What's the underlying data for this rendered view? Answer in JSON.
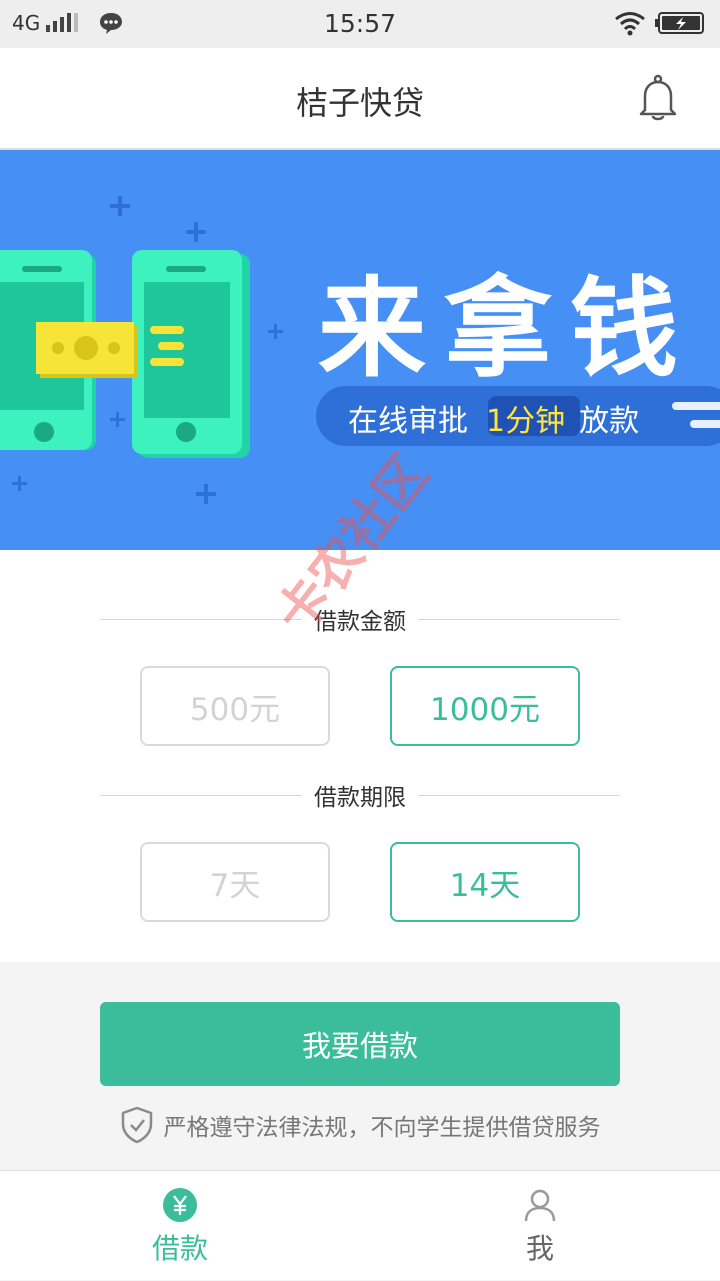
{
  "status_bar": {
    "network": "4G",
    "time": "15:57"
  },
  "header": {
    "title": "桔子快贷"
  },
  "banner": {
    "headline": "来拿钱",
    "subtitle_pre": "在线审批",
    "subtitle_highlight": "1分钟",
    "subtitle_post": "放款"
  },
  "amount": {
    "title": "借款金额",
    "options": [
      "500元",
      "1000元"
    ],
    "selected_index": 1
  },
  "term": {
    "title": "借款期限",
    "options": [
      "7天",
      "14天"
    ],
    "selected_index": 1
  },
  "cta": {
    "label": "我要借款"
  },
  "notice": {
    "text": "严格遵守法律法规，不向学生提供借贷服务"
  },
  "tabs": [
    {
      "label": "借款",
      "active": true
    },
    {
      "label": "我",
      "active": false
    }
  ],
  "watermark": {
    "text": "卡农社区"
  },
  "colors": {
    "accent": "#3bbd9b",
    "banner_bg": "#4690f5"
  }
}
